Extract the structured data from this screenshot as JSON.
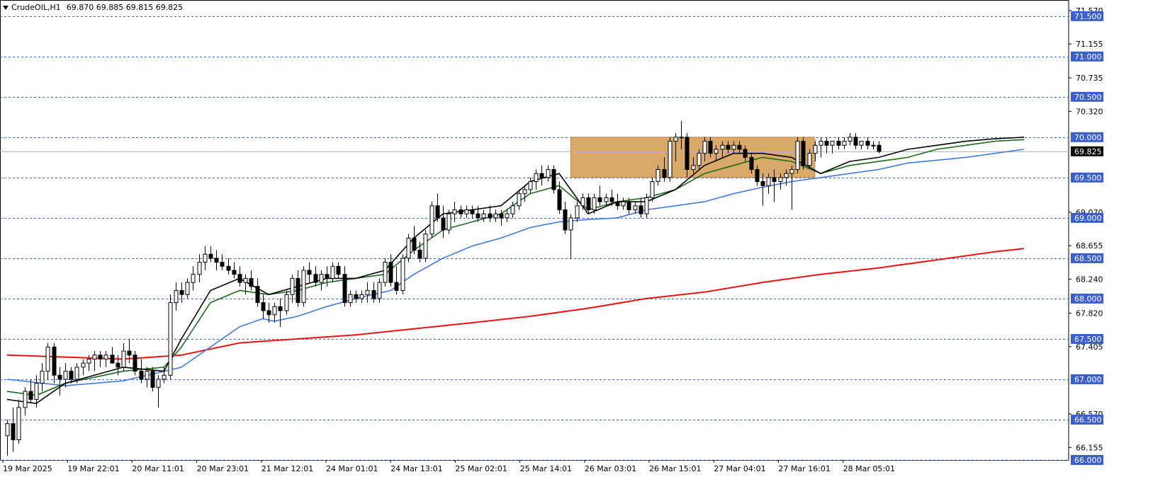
{
  "title_bar": {
    "symbol": "CrudeOIL,H1",
    "ohlc": "69.870 69.885 69.815 69.825"
  },
  "colors": {
    "background": "#ffffff",
    "grid": "#3c5fd0",
    "level_label_bg": "#3c5fd0",
    "ma_black": "#000000",
    "ma_green": "#1a6b1a",
    "ma_blue": "#3f7be0",
    "ma_red": "#ee1111",
    "zone": "#d9a96a",
    "current_price_bg": "#000000"
  },
  "chart_data": {
    "type": "candlestick",
    "title": "CrudeOIL,H1",
    "price_ticks": [
      "71.570",
      "71.155",
      "70.735",
      "70.320",
      "69.070",
      "68.655",
      "68.240",
      "67.820",
      "67.405",
      "66.570",
      "66.155"
    ],
    "horizontal_levels": [
      "71.500",
      "71.000",
      "70.500",
      "70.000",
      "69.500",
      "69.000",
      "68.500",
      "68.000",
      "67.500",
      "67.000",
      "66.500",
      "66.000"
    ],
    "current_price": "69.825",
    "x_labels": [
      "19 Mar 2025",
      "19 Mar 22:01",
      "20 Mar 11:01",
      "20 Mar 23:01",
      "21 Mar 12:01",
      "24 Mar 01:01",
      "24 Mar 13:01",
      "25 Mar 02:01",
      "25 Mar 14:01",
      "26 Mar 03:01",
      "26 Mar 15:01",
      "27 Mar 04:01",
      "27 Mar 16:01",
      "28 Mar 05:01"
    ],
    "ylim": [
      66.0,
      71.7
    ],
    "zone": {
      "from_bar": 97,
      "to_bar": 139,
      "low": 69.5,
      "high": 70.0
    },
    "candles": [
      [
        66.3,
        66.5,
        66.05,
        66.45
      ],
      [
        66.45,
        66.65,
        66.1,
        66.25
      ],
      [
        66.25,
        66.75,
        66.2,
        66.65
      ],
      [
        66.65,
        66.9,
        66.55,
        66.85
      ],
      [
        66.85,
        67.0,
        66.7,
        66.75
      ],
      [
        66.75,
        67.05,
        66.65,
        66.95
      ],
      [
        66.95,
        67.2,
        66.85,
        67.1
      ],
      [
        67.1,
        67.45,
        67.0,
        67.4
      ],
      [
        67.4,
        67.45,
        66.95,
        67.05
      ],
      [
        67.05,
        67.15,
        66.8,
        67.0
      ],
      [
        67.0,
        67.2,
        66.9,
        67.1
      ],
      [
        67.1,
        67.15,
        66.95,
        67.0
      ],
      [
        67.0,
        67.2,
        66.95,
        67.15
      ],
      [
        67.15,
        67.25,
        67.05,
        67.2
      ],
      [
        67.2,
        67.3,
        67.1,
        67.25
      ],
      [
        67.25,
        67.35,
        67.1,
        67.3
      ],
      [
        67.3,
        67.35,
        67.15,
        67.25
      ],
      [
        67.25,
        67.35,
        67.15,
        67.3
      ],
      [
        67.3,
        67.4,
        67.2,
        67.2
      ],
      [
        67.2,
        67.3,
        67.05,
        67.15
      ],
      [
        67.15,
        67.45,
        67.1,
        67.35
      ],
      [
        67.35,
        67.5,
        67.2,
        67.3
      ],
      [
        67.3,
        67.35,
        67.05,
        67.1
      ],
      [
        67.1,
        67.25,
        66.95,
        67.0
      ],
      [
        67.0,
        67.15,
        66.9,
        67.1
      ],
      [
        67.1,
        67.15,
        66.85,
        66.9
      ],
      [
        66.9,
        67.05,
        66.65,
        67.0
      ],
      [
        67.0,
        67.15,
        66.95,
        67.05
      ],
      [
        67.05,
        68.05,
        67.0,
        67.95
      ],
      [
        67.95,
        68.2,
        67.85,
        68.1
      ],
      [
        68.1,
        68.2,
        67.95,
        68.05
      ],
      [
        68.05,
        68.25,
        68.0,
        68.2
      ],
      [
        68.2,
        68.4,
        68.1,
        68.3
      ],
      [
        68.3,
        68.55,
        68.2,
        68.45
      ],
      [
        68.45,
        68.65,
        68.35,
        68.55
      ],
      [
        68.55,
        68.65,
        68.45,
        68.5
      ],
      [
        68.5,
        68.6,
        68.35,
        68.45
      ],
      [
        68.45,
        68.55,
        68.35,
        68.4
      ],
      [
        68.4,
        68.5,
        68.3,
        68.35
      ],
      [
        68.35,
        68.45,
        68.25,
        68.3
      ],
      [
        68.3,
        68.4,
        68.15,
        68.2
      ],
      [
        68.2,
        68.3,
        68.05,
        68.25
      ],
      [
        68.25,
        68.35,
        68.1,
        68.15
      ],
      [
        68.15,
        68.25,
        67.9,
        67.95
      ],
      [
        67.95,
        68.05,
        67.75,
        67.85
      ],
      [
        67.85,
        67.95,
        67.7,
        67.8
      ],
      [
        67.8,
        67.95,
        67.7,
        67.9
      ],
      [
        67.9,
        68.0,
        67.65,
        67.85
      ],
      [
        67.85,
        68.1,
        67.8,
        68.05
      ],
      [
        68.05,
        68.3,
        67.95,
        68.25
      ],
      [
        68.25,
        68.35,
        67.9,
        67.95
      ],
      [
        67.95,
        68.4,
        67.9,
        68.35
      ],
      [
        68.35,
        68.45,
        68.2,
        68.3
      ],
      [
        68.3,
        68.4,
        68.15,
        68.2
      ],
      [
        68.2,
        68.35,
        68.1,
        68.3
      ],
      [
        68.3,
        68.4,
        68.15,
        68.25
      ],
      [
        68.25,
        68.45,
        68.2,
        68.4
      ],
      [
        68.4,
        68.45,
        68.25,
        68.3
      ],
      [
        68.3,
        68.4,
        67.9,
        67.95
      ],
      [
        67.95,
        68.1,
        67.9,
        68.05
      ],
      [
        68.05,
        68.1,
        67.95,
        68.0
      ],
      [
        68.0,
        68.1,
        67.95,
        68.05
      ],
      [
        68.05,
        68.2,
        67.95,
        68.1
      ],
      [
        68.1,
        68.2,
        67.95,
        68.0
      ],
      [
        68.0,
        68.25,
        67.95,
        68.2
      ],
      [
        68.2,
        68.5,
        68.15,
        68.45
      ],
      [
        68.45,
        68.55,
        68.15,
        68.2
      ],
      [
        68.2,
        68.4,
        68.05,
        68.1
      ],
      [
        68.1,
        68.55,
        68.05,
        68.5
      ],
      [
        68.5,
        68.8,
        68.45,
        68.75
      ],
      [
        68.75,
        68.9,
        68.55,
        68.6
      ],
      [
        68.6,
        68.7,
        68.45,
        68.5
      ],
      [
        68.5,
        68.85,
        68.45,
        68.8
      ],
      [
        68.8,
        69.2,
        68.75,
        69.15
      ],
      [
        69.15,
        69.3,
        68.95,
        69.0
      ],
      [
        69.0,
        69.15,
        68.75,
        68.85
      ],
      [
        68.85,
        69.1,
        68.8,
        69.05
      ],
      [
        69.05,
        69.2,
        68.95,
        69.1
      ],
      [
        69.1,
        69.15,
        69.0,
        69.05
      ],
      [
        69.05,
        69.15,
        69.0,
        69.1
      ],
      [
        69.1,
        69.15,
        69.0,
        69.05
      ],
      [
        69.05,
        69.15,
        68.95,
        69.0
      ],
      [
        69.0,
        69.1,
        68.95,
        69.05
      ],
      [
        69.05,
        69.15,
        68.95,
        69.0
      ],
      [
        69.0,
        69.1,
        68.95,
        69.05
      ],
      [
        69.05,
        69.1,
        68.9,
        69.0
      ],
      [
        69.0,
        69.1,
        68.95,
        69.05
      ],
      [
        69.05,
        69.2,
        69.0,
        69.15
      ],
      [
        69.15,
        69.35,
        69.1,
        69.3
      ],
      [
        69.3,
        69.4,
        69.2,
        69.35
      ],
      [
        69.35,
        69.5,
        69.3,
        69.45
      ],
      [
        69.45,
        69.6,
        69.35,
        69.55
      ],
      [
        69.55,
        69.65,
        69.4,
        69.5
      ],
      [
        69.5,
        69.65,
        69.45,
        69.6
      ],
      [
        69.6,
        69.65,
        69.3,
        69.35
      ],
      [
        69.35,
        69.45,
        69.05,
        69.1
      ],
      [
        69.1,
        69.2,
        68.8,
        68.85
      ],
      [
        68.85,
        69.05,
        68.5,
        69.0
      ],
      [
        69.0,
        69.2,
        68.95,
        69.15
      ],
      [
        69.15,
        69.3,
        69.1,
        69.25
      ],
      [
        69.25,
        69.3,
        69.05,
        69.1
      ],
      [
        69.1,
        69.3,
        69.05,
        69.25
      ],
      [
        69.25,
        69.4,
        69.15,
        69.2
      ],
      [
        69.2,
        69.3,
        69.15,
        69.25
      ],
      [
        69.25,
        69.35,
        69.15,
        69.2
      ],
      [
        69.2,
        69.3,
        69.1,
        69.15
      ],
      [
        69.15,
        69.25,
        69.1,
        69.2
      ],
      [
        69.2,
        69.25,
        69.05,
        69.1
      ],
      [
        69.1,
        69.2,
        69.05,
        69.15
      ],
      [
        69.15,
        69.25,
        69.0,
        69.05
      ],
      [
        69.05,
        69.3,
        69.0,
        69.25
      ],
      [
        69.25,
        69.5,
        69.2,
        69.45
      ],
      [
        69.45,
        69.65,
        69.4,
        69.6
      ],
      [
        69.6,
        69.75,
        69.45,
        69.5
      ],
      [
        69.5,
        70.0,
        69.45,
        69.95
      ],
      [
        69.95,
        70.05,
        69.7,
        70.0
      ],
      [
        70.0,
        70.2,
        69.85,
        70.0
      ],
      [
        70.0,
        70.05,
        69.5,
        69.6
      ],
      [
        69.6,
        69.75,
        69.55,
        69.65
      ],
      [
        69.65,
        69.85,
        69.6,
        69.8
      ],
      [
        69.8,
        70.0,
        69.7,
        69.95
      ],
      [
        69.95,
        70.0,
        69.75,
        69.8
      ],
      [
        69.8,
        69.9,
        69.7,
        69.85
      ],
      [
        69.85,
        69.95,
        69.75,
        69.9
      ],
      [
        69.9,
        69.95,
        69.8,
        69.85
      ],
      [
        69.85,
        69.95,
        69.8,
        69.9
      ],
      [
        69.9,
        69.95,
        69.8,
        69.85
      ],
      [
        69.85,
        69.9,
        69.7,
        69.75
      ],
      [
        69.75,
        69.8,
        69.55,
        69.6
      ],
      [
        69.6,
        69.65,
        69.4,
        69.45
      ],
      [
        69.45,
        69.55,
        69.15,
        69.4
      ],
      [
        69.4,
        69.55,
        69.3,
        69.5
      ],
      [
        69.5,
        69.6,
        69.2,
        69.45
      ],
      [
        69.45,
        69.55,
        69.35,
        69.5
      ],
      [
        69.5,
        69.6,
        69.4,
        69.55
      ],
      [
        69.55,
        69.65,
        69.1,
        69.6
      ],
      [
        69.6,
        70.0,
        69.55,
        69.95
      ],
      [
        69.95,
        70.0,
        69.6,
        69.65
      ],
      [
        69.65,
        69.85,
        69.6,
        69.8
      ],
      [
        69.8,
        69.95,
        69.7,
        69.9
      ],
      [
        69.9,
        70.0,
        69.75,
        69.95
      ],
      [
        69.95,
        70.0,
        69.8,
        69.9
      ],
      [
        69.9,
        69.95,
        69.8,
        69.95
      ],
      [
        69.95,
        70.0,
        69.85,
        69.9
      ],
      [
        69.9,
        70.0,
        69.85,
        69.95
      ],
      [
        69.95,
        70.05,
        69.9,
        70.0
      ],
      [
        70.0,
        70.05,
        69.85,
        69.9
      ],
      [
        69.9,
        69.95,
        69.85,
        69.95
      ],
      [
        69.95,
        70.0,
        69.85,
        69.9
      ],
      [
        69.9,
        69.95,
        69.85,
        69.9
      ],
      [
        69.9,
        69.95,
        69.8,
        69.825
      ]
    ],
    "ma_red": [
      [
        0,
        67.3
      ],
      [
        20,
        67.25
      ],
      [
        30,
        67.3
      ],
      [
        40,
        67.45
      ],
      [
        60,
        67.55
      ],
      [
        80,
        67.7
      ],
      [
        90,
        67.78
      ],
      [
        100,
        67.88
      ],
      [
        110,
        68.0
      ],
      [
        120,
        68.08
      ],
      [
        130,
        68.2
      ],
      [
        140,
        68.3
      ],
      [
        150,
        68.38
      ],
      [
        160,
        68.48
      ],
      [
        170,
        68.58
      ],
      [
        175,
        68.62
      ]
    ],
    "ma_blue": [
      [
        0,
        67.0
      ],
      [
        10,
        66.92
      ],
      [
        20,
        66.98
      ],
      [
        30,
        67.15
      ],
      [
        40,
        67.65
      ],
      [
        44,
        67.75
      ],
      [
        46,
        67.72
      ],
      [
        50,
        67.78
      ],
      [
        55,
        67.9
      ],
      [
        60,
        68.0
      ],
      [
        66,
        68.1
      ],
      [
        70,
        68.3
      ],
      [
        75,
        68.5
      ],
      [
        80,
        68.65
      ],
      [
        85,
        68.75
      ],
      [
        90,
        68.88
      ],
      [
        95,
        68.95
      ],
      [
        100,
        68.98
      ],
      [
        105,
        69.0
      ],
      [
        110,
        69.1
      ],
      [
        115,
        69.15
      ],
      [
        120,
        69.2
      ],
      [
        125,
        69.3
      ],
      [
        130,
        69.38
      ],
      [
        135,
        69.45
      ],
      [
        140,
        69.5
      ],
      [
        145,
        69.55
      ],
      [
        150,
        69.6
      ],
      [
        155,
        69.68
      ],
      [
        165,
        69.75
      ],
      [
        170,
        69.8
      ],
      [
        175,
        69.85
      ]
    ],
    "ma_green": [
      [
        0,
        66.85
      ],
      [
        5,
        66.8
      ],
      [
        10,
        66.95
      ],
      [
        20,
        67.1
      ],
      [
        27,
        67.15
      ],
      [
        30,
        67.4
      ],
      [
        35,
        67.95
      ],
      [
        40,
        68.1
      ],
      [
        45,
        68.05
      ],
      [
        50,
        68.1
      ],
      [
        55,
        68.2
      ],
      [
        60,
        68.25
      ],
      [
        65,
        68.3
      ],
      [
        70,
        68.6
      ],
      [
        75,
        68.85
      ],
      [
        80,
        68.95
      ],
      [
        85,
        69.05
      ],
      [
        90,
        69.3
      ],
      [
        95,
        69.4
      ],
      [
        100,
        69.1
      ],
      [
        105,
        69.2
      ],
      [
        110,
        69.25
      ],
      [
        115,
        69.35
      ],
      [
        120,
        69.55
      ],
      [
        125,
        69.65
      ],
      [
        130,
        69.75
      ],
      [
        135,
        69.7
      ],
      [
        140,
        69.55
      ],
      [
        145,
        69.65
      ],
      [
        150,
        69.7
      ],
      [
        155,
        69.75
      ],
      [
        160,
        69.85
      ],
      [
        165,
        69.9
      ],
      [
        170,
        69.95
      ],
      [
        175,
        69.97
      ]
    ],
    "ma_black": [
      [
        0,
        66.75
      ],
      [
        5,
        66.7
      ],
      [
        10,
        66.95
      ],
      [
        20,
        67.15
      ],
      [
        27,
        67.1
      ],
      [
        30,
        67.5
      ],
      [
        35,
        68.1
      ],
      [
        40,
        68.25
      ],
      [
        45,
        68.05
      ],
      [
        50,
        68.15
      ],
      [
        55,
        68.25
      ],
      [
        60,
        68.25
      ],
      [
        65,
        68.35
      ],
      [
        70,
        68.75
      ],
      [
        75,
        69.05
      ],
      [
        80,
        69.1
      ],
      [
        85,
        69.15
      ],
      [
        90,
        69.45
      ],
      [
        95,
        69.55
      ],
      [
        100,
        69.05
      ],
      [
        105,
        69.2
      ],
      [
        110,
        69.2
      ],
      [
        115,
        69.35
      ],
      [
        120,
        69.65
      ],
      [
        125,
        69.8
      ],
      [
        130,
        69.8
      ],
      [
        135,
        69.75
      ],
      [
        140,
        69.55
      ],
      [
        145,
        69.7
      ],
      [
        150,
        69.75
      ],
      [
        155,
        69.85
      ],
      [
        160,
        69.9
      ],
      [
        165,
        69.95
      ],
      [
        170,
        69.98
      ],
      [
        175,
        70.0
      ]
    ]
  }
}
